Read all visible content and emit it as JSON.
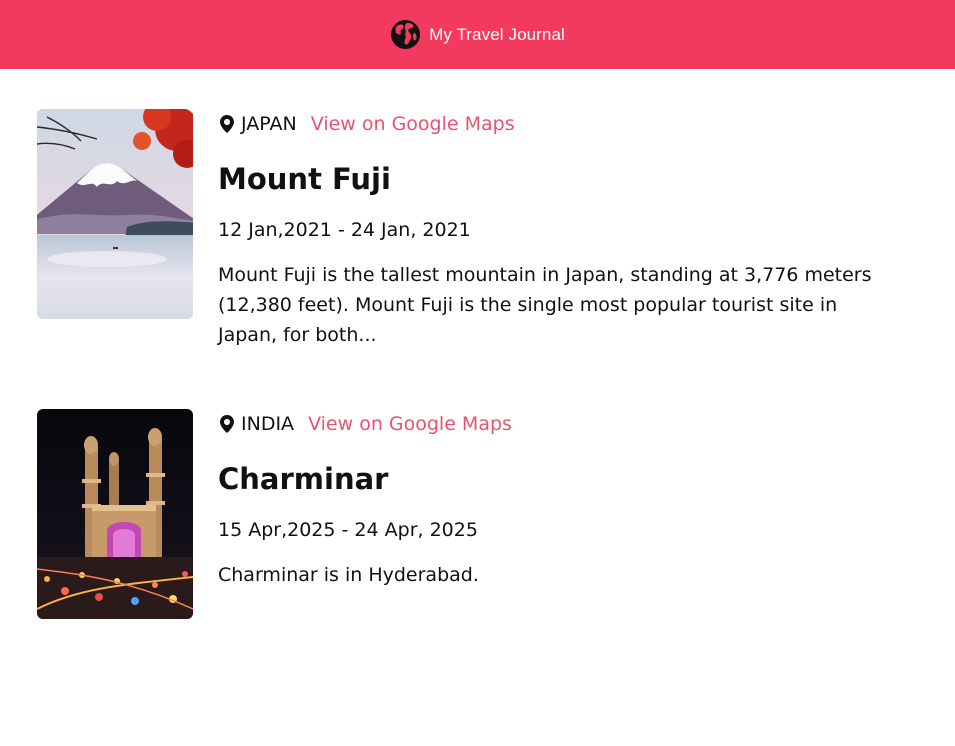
{
  "header": {
    "title": "My Travel Journal",
    "icon": "globe-icon",
    "bg_color": "#F33A5E"
  },
  "entries": [
    {
      "country": "JAPAN",
      "map_link_label": "View on Google Maps",
      "title": "Mount Fuji",
      "dates": "12 Jan,2021 - 24 Jan, 2021",
      "description": "Mount Fuji is the tallest mountain in Japan, standing at 3,776 meters (12,380 feet). Mount Fuji is the single most popular tourist site in Japan, for both..."
    },
    {
      "country": "INDIA",
      "map_link_label": "View on Google Maps",
      "title": "Charminar",
      "dates": "15 Apr,2025 - 24 Apr, 2025",
      "description": "Charminar is in Hyderabad."
    }
  ],
  "colors": {
    "accent": "#F33A5E",
    "link": "#E8536F"
  }
}
